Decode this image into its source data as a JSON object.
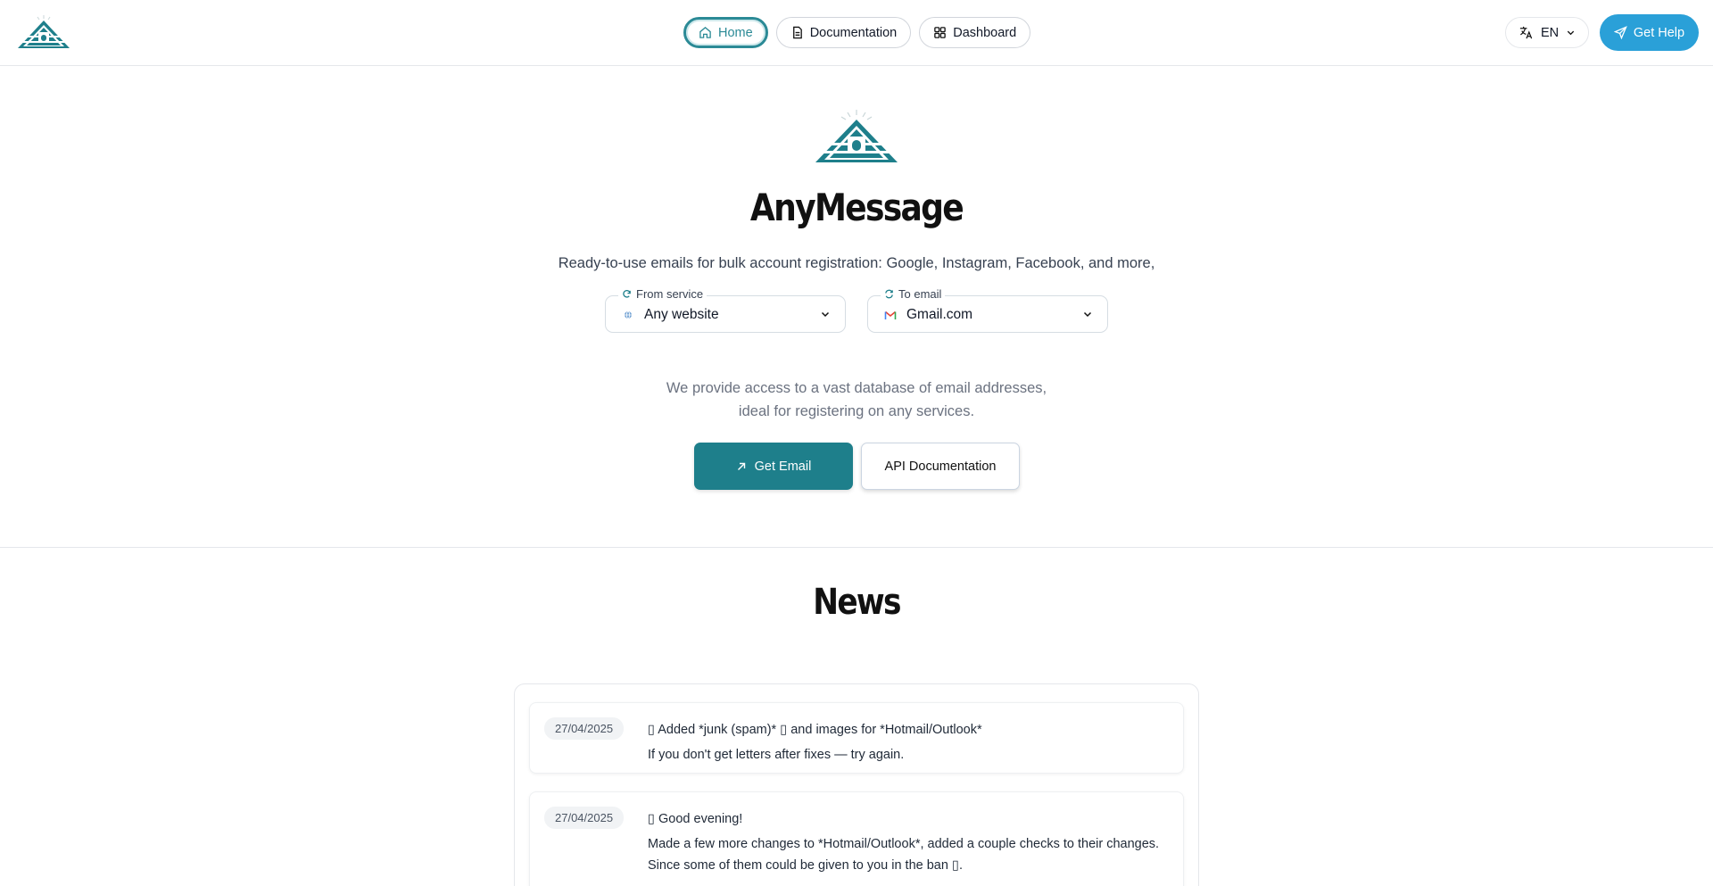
{
  "header": {
    "nav": [
      {
        "label": "Home",
        "icon": "home-icon",
        "active": true
      },
      {
        "label": "Documentation",
        "icon": "document-icon",
        "active": false
      },
      {
        "label": "Dashboard",
        "icon": "grid-icon",
        "active": false
      }
    ],
    "language": {
      "label": "EN",
      "icon": "translate-icon"
    },
    "help_button": {
      "label": "Get Help",
      "icon": "send-icon"
    }
  },
  "hero": {
    "title": "AnyMessage",
    "tagline": "Ready-to-use emails for bulk account registration: Google, Instagram, Facebook, and more,",
    "from_service": {
      "legend": "From service",
      "value": "Any website",
      "icon": "globe-icon"
    },
    "to_email": {
      "legend": "To email",
      "value": "Gmail.com",
      "icon": "gmail-icon"
    },
    "description_line1": "We provide access to a vast database of email addresses,",
    "description_line2": "ideal for registering on any services.",
    "get_email_label": "Get Email",
    "api_doc_label": "API Documentation"
  },
  "news": {
    "title": "News",
    "items": [
      {
        "date": "27/04/2025",
        "line1": "▯ Added *junk (spam)* ▯ and images for *Hotmail/Outlook*",
        "line2": "If you don't get letters after fixes — try again."
      },
      {
        "date": "27/04/2025",
        "line1": "▯ Good evening!",
        "line2": "Made a few more changes to *Hotmail/Outlook*, added a couple checks to their changes. Since some of them could be given to you in the ban ▯."
      }
    ]
  },
  "colors": {
    "accent": "#1e7f8b",
    "help": "#2aa0d8",
    "active_nav": "#2b8a96"
  }
}
